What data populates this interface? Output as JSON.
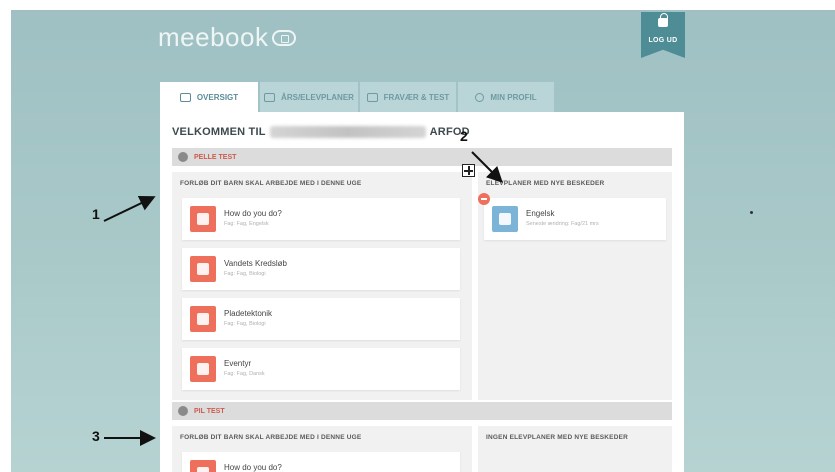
{
  "brand": {
    "logo_text": "meebook",
    "logo_icon": "cloud-icon"
  },
  "header": {
    "logout_label": "LOG UD",
    "logout_icon": "lock-icon"
  },
  "tabs": [
    {
      "label": "OVERSIGT",
      "icon": "monitor-icon",
      "active": true
    },
    {
      "label": "ÅRS/ELEVPLANER",
      "icon": "calendar-icon",
      "active": false
    },
    {
      "label": "FRAVÆR & TEST",
      "icon": "monitor-icon",
      "active": false
    },
    {
      "label": "MIN PROFIL",
      "icon": "person-icon",
      "active": false
    }
  ],
  "welcome": {
    "prefix": "VELKOMMEN TIL",
    "suffix": "ARFOD"
  },
  "students": [
    {
      "name": "PELLE TEST",
      "left_title": "FORLØB DIT BARN SKAL ARBEJDE MED I DENNE UGE",
      "right_title": "ELEVPLANER MED NYE BESKEDER",
      "courses": [
        {
          "title": "How do you do?",
          "subtitle": "Fag: Fag, Engelsk"
        },
        {
          "title": "Vandets Kredsløb",
          "subtitle": "Fag: Fag, Biologi"
        },
        {
          "title": "Pladetektonik",
          "subtitle": "Fag: Fag, Biologi"
        },
        {
          "title": "Eventyr",
          "subtitle": "Fag: Fag, Dansk"
        }
      ],
      "plans": [
        {
          "title": "Engelsk",
          "subtitle": "Seneste ændring: Fag/21 mrs"
        }
      ]
    },
    {
      "name": "PIL TEST",
      "left_title": "FORLØB DIT BARN SKAL ARBEJDE MED I DENNE UGE",
      "right_title": "INGEN ELEVPLANER MED NYE BESKEDER",
      "courses": [
        {
          "title": "How do you do?",
          "subtitle": ""
        }
      ]
    }
  ],
  "annotations": {
    "a1": "1",
    "a2": "2",
    "a3": "3"
  },
  "colors": {
    "accent": "#4f8d96",
    "course_icon": "#ef6f5d",
    "plan_icon": "#7bb4d6",
    "student_name": "#cc5a4e"
  }
}
